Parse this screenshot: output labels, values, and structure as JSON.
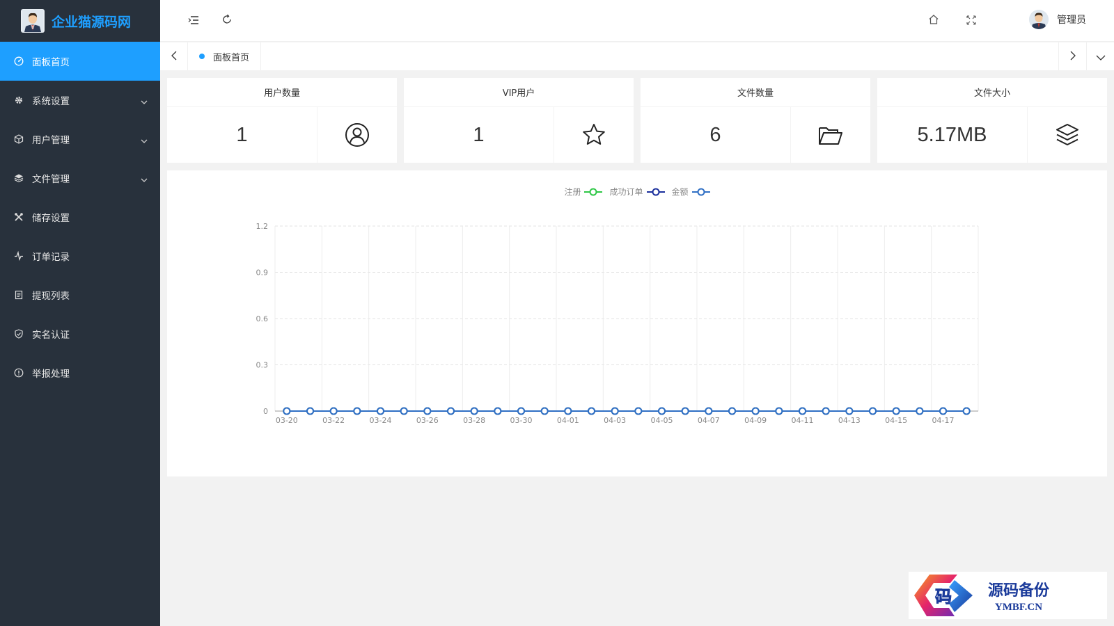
{
  "app": {
    "brand_title": "企业猫源码网"
  },
  "sidebar": {
    "items": [
      {
        "label": "面板首页",
        "icon": "dashboard-icon",
        "active": true,
        "has_children": false
      },
      {
        "label": "系统设置",
        "icon": "gear-icon",
        "active": false,
        "has_children": true
      },
      {
        "label": "用户管理",
        "icon": "cube-icon",
        "active": false,
        "has_children": true
      },
      {
        "label": "文件管理",
        "icon": "layers-icon",
        "active": false,
        "has_children": true
      },
      {
        "label": "储存设置",
        "icon": "tools-icon",
        "active": false,
        "has_children": false
      },
      {
        "label": "订单记录",
        "icon": "pulse-icon",
        "active": false,
        "has_children": false
      },
      {
        "label": "提现列表",
        "icon": "list-doc-icon",
        "active": false,
        "has_children": false
      },
      {
        "label": "实名认证",
        "icon": "shield-check-icon",
        "active": false,
        "has_children": false
      },
      {
        "label": "举报处理",
        "icon": "info-circle-icon",
        "active": false,
        "has_children": false
      }
    ]
  },
  "header": {
    "user_name": "管理员"
  },
  "tabs": {
    "items": [
      {
        "label": "面板首页"
      }
    ]
  },
  "stats": [
    {
      "title": "用户数量",
      "value": "1",
      "icon": "user-circle-icon"
    },
    {
      "title": "VIP用户",
      "value": "1",
      "icon": "star-icon"
    },
    {
      "title": "文件数量",
      "value": "6",
      "icon": "folder-open-icon"
    },
    {
      "title": "文件大小",
      "value": "5.17MB",
      "icon": "layers-icon"
    }
  ],
  "watermark": {
    "cn": "源码备份",
    "en": "YMBF.CN"
  },
  "colors": {
    "accent": "#1e9fff",
    "sidebar_bg": "#28313c",
    "series_register": "#2ec746",
    "series_orders": "#1a2e9c",
    "series_amount": "#2f6fc4"
  },
  "chart_data": {
    "type": "line",
    "title": "",
    "xlabel": "",
    "ylabel": "",
    "x": [
      "03-20",
      "03-21",
      "03-22",
      "03-23",
      "03-24",
      "03-25",
      "03-26",
      "03-27",
      "03-28",
      "03-29",
      "03-30",
      "03-31",
      "04-01",
      "04-02",
      "04-03",
      "04-04",
      "04-05",
      "04-06",
      "04-07",
      "04-08",
      "04-09",
      "04-10",
      "04-11",
      "04-12",
      "04-13",
      "04-14",
      "04-15",
      "04-16",
      "04-17",
      "04-18"
    ],
    "x_tick_labels": [
      "03-20",
      "03-22",
      "03-24",
      "03-26",
      "03-28",
      "03-30",
      "04-01",
      "04-03",
      "04-05",
      "04-07",
      "04-09",
      "04-11",
      "04-13",
      "04-15",
      "04-17"
    ],
    "ylim": [
      0,
      1.2
    ],
    "y_ticks": [
      "0",
      "0.3",
      "0.6",
      "0.9",
      "1.2"
    ],
    "grid": true,
    "legend_position": "top-center",
    "series": [
      {
        "name": "注册",
        "values": [
          0,
          0,
          0,
          0,
          0,
          0,
          0,
          0,
          0,
          0,
          0,
          0,
          0,
          0,
          0,
          0,
          0,
          0,
          0,
          0,
          0,
          0,
          0,
          0,
          0,
          0,
          0,
          0,
          0,
          0
        ]
      },
      {
        "name": "成功订单",
        "values": [
          0,
          0,
          0,
          0,
          0,
          0,
          0,
          0,
          0,
          0,
          0,
          0,
          0,
          0,
          0,
          0,
          0,
          0,
          0,
          0,
          0,
          0,
          0,
          0,
          0,
          0,
          0,
          0,
          0,
          0
        ]
      },
      {
        "name": "金额",
        "values": [
          0,
          0,
          0,
          0,
          0,
          0,
          0,
          0,
          0,
          0,
          0,
          0,
          0,
          0,
          0,
          0,
          0,
          0,
          0,
          0,
          0,
          0,
          0,
          0,
          0,
          0,
          0,
          0,
          0,
          0
        ]
      }
    ]
  }
}
